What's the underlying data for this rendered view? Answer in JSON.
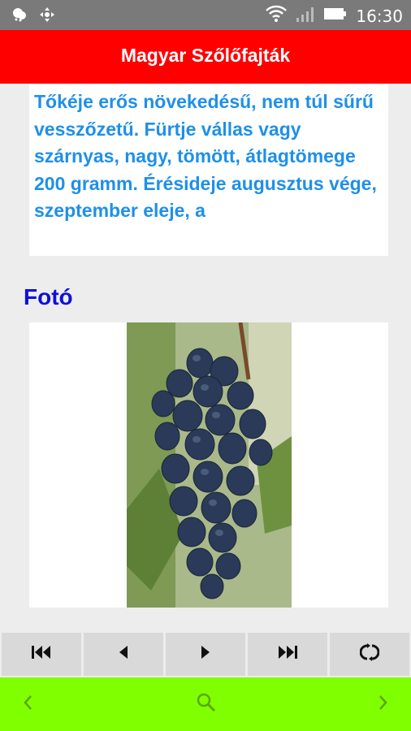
{
  "status": {
    "time": "16:30"
  },
  "app": {
    "title": "Magyar Szőlőfajták"
  },
  "description": "Tőkéje erős növekedésű, nem túl sűrű vesszőzetű. Fürtje vállas vagy szárnyas, nagy, tömött, átlagtömege 200 gramm. Érésideje augusztus vége, szeptember eleje, a",
  "photo_section": {
    "title": "Fotó"
  },
  "nav": [
    "first-icon",
    "previous-icon",
    "next-icon",
    "last-icon",
    "refresh-icon"
  ],
  "bottom": [
    "back-icon",
    "search-icon",
    "forward-icon"
  ]
}
